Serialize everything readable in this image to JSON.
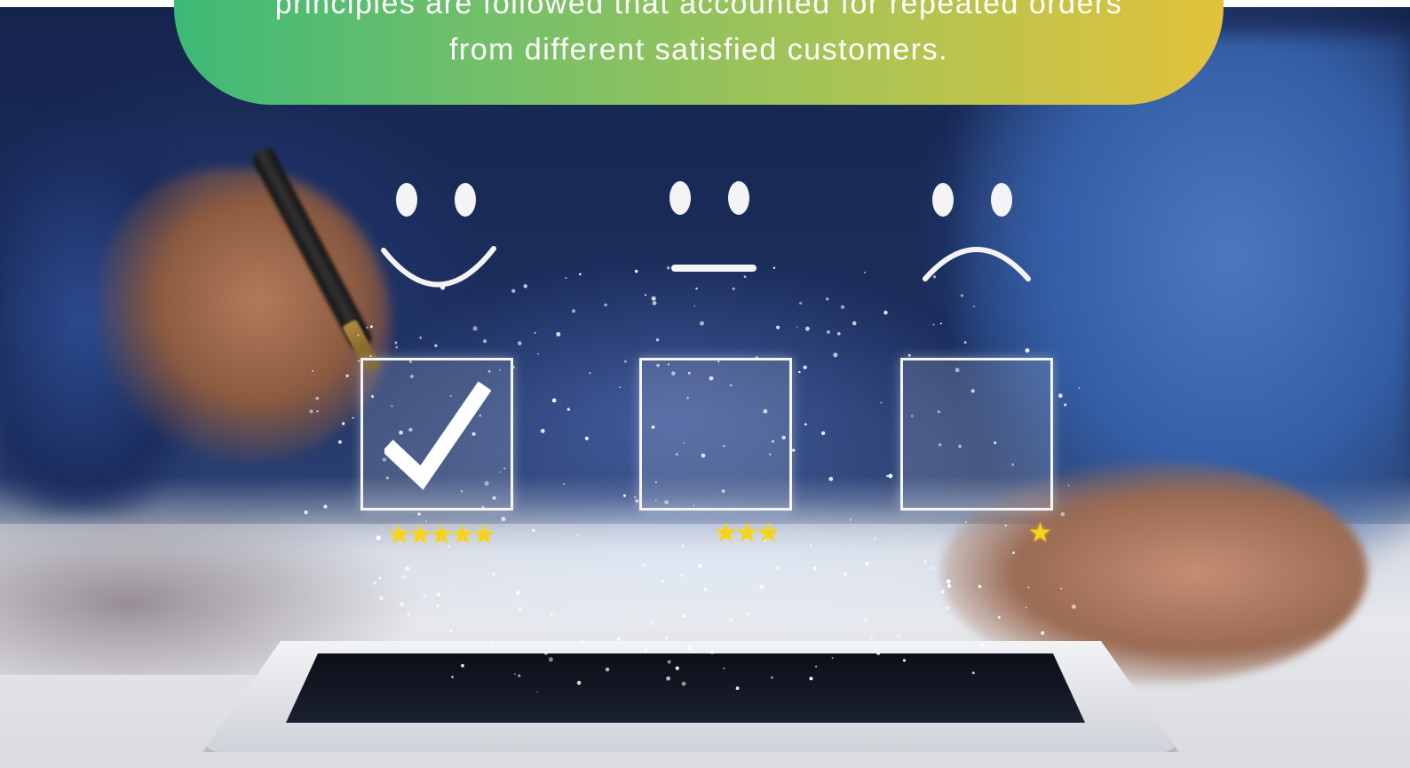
{
  "banner": {
    "line1": "principles are followed that accounted for repeated orders",
    "line2": "from different satisfied customers."
  },
  "ratings": [
    {
      "face": "happy-face",
      "checked": true,
      "stars": 5,
      "star_text": "★★★★★"
    },
    {
      "face": "neutral-face",
      "checked": false,
      "stars": 3,
      "star_text": "★★★"
    },
    {
      "face": "sad-face",
      "checked": false,
      "stars": 1,
      "star_text": "★"
    }
  ],
  "colors": {
    "banner_start": "#3dba77",
    "banner_end": "#e3c23a",
    "star": "#f6d31a",
    "icon_white": "#f4f4f6"
  }
}
